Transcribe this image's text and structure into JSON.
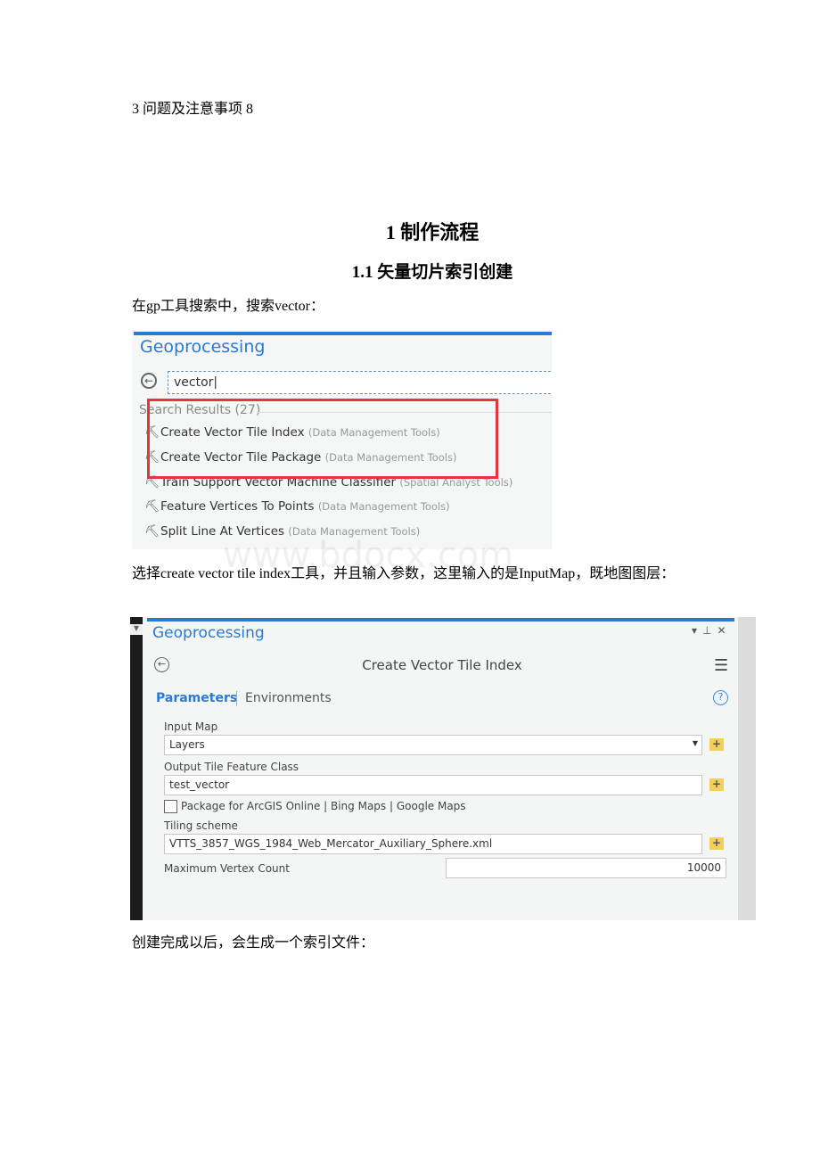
{
  "toc_line": "3 问题及注意事项 8",
  "heading1": "1 制作流程",
  "heading2": "1.1  矢量切片索引创建",
  "para1": "在gp工具搜索中，搜索vector：",
  "shot1": {
    "title": "Geoprocessing",
    "search_value": "vector",
    "results_label": "Search Results (27)",
    "results": [
      {
        "name": "Create Vector Tile Index",
        "category": "(Data Management Tools)"
      },
      {
        "name": "Create Vector Tile Package",
        "category": "(Data Management Tools)"
      },
      {
        "name": "Train Support Vector Machine Classifier",
        "category": "(Spatial Analyst Tools)"
      },
      {
        "name": "Feature Vertices To Points",
        "category": "(Data Management Tools)"
      },
      {
        "name": "Split Line At Vertices",
        "category": "(Data Management Tools)"
      }
    ],
    "highlight_color": "#e8343a"
  },
  "para2": "选择create vector tile index工具，并且输入参数，这里输入的是InputMap，既地图图层：",
  "shot2": {
    "title": "Geoprocessing",
    "tool_title": "Create Vector Tile Index",
    "tab_parameters": "Parameters",
    "tab_environments": "Environments",
    "input_map_label": "Input Map",
    "input_map_value": "Layers",
    "output_label": "Output Tile Feature Class",
    "output_value": "test_vector",
    "package_label": "Package for ArcGIS Online | Bing Maps | Google Maps",
    "package_checked": false,
    "tiling_label": "Tiling scheme",
    "tiling_value": "VTTS_3857_WGS_1984_Web_Mercator_Auxiliary_Sphere.xml",
    "max_vertex_label": "Maximum Vertex Count",
    "max_vertex_value": "10000",
    "accent_color": "#2a7ad0"
  },
  "para3": "创建完成以后，会生成一个索引文件：",
  "watermark": "www.bdocx.com"
}
